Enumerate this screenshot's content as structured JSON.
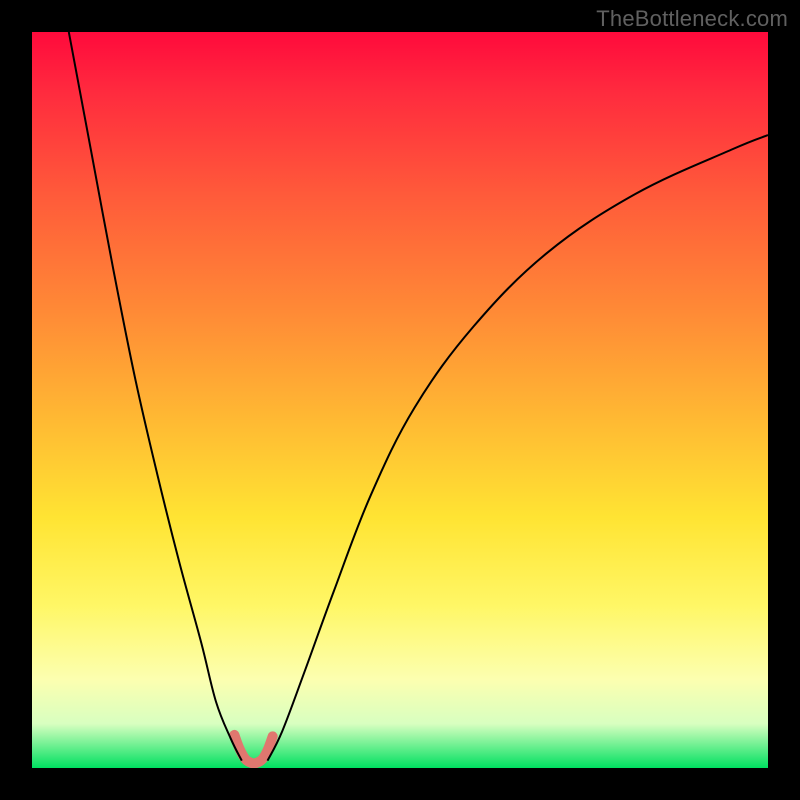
{
  "watermark": "TheBottleneck.com",
  "chart_data": {
    "type": "line",
    "title": "",
    "xlabel": "",
    "ylabel": "",
    "xlim": [
      0,
      100
    ],
    "ylim": [
      0,
      100
    ],
    "background_gradient": {
      "orientation": "vertical",
      "stops": [
        {
          "pos": 0,
          "color": "#ff0a3c"
        },
        {
          "pos": 22,
          "color": "#ff5a3a"
        },
        {
          "pos": 52,
          "color": "#ffb733"
        },
        {
          "pos": 78,
          "color": "#fff766"
        },
        {
          "pos": 94,
          "color": "#d8ffc0"
        },
        {
          "pos": 100,
          "color": "#00e060"
        }
      ]
    },
    "series": [
      {
        "name": "curve-left",
        "stroke": "#000000",
        "stroke_width": 2,
        "x": [
          5,
          8,
          11,
          14,
          17,
          20,
          23,
          25,
          27,
          28.5
        ],
        "y": [
          100,
          84,
          68,
          53,
          40,
          28,
          17,
          9,
          4,
          1
        ]
      },
      {
        "name": "curve-right",
        "stroke": "#000000",
        "stroke_width": 2,
        "x": [
          32,
          34,
          37,
          41,
          46,
          52,
          60,
          70,
          82,
          95,
          100
        ],
        "y": [
          1,
          5,
          13,
          24,
          37,
          49,
          60,
          70,
          78,
          84,
          86
        ]
      },
      {
        "name": "valley-highlight",
        "stroke": "#e0776f",
        "stroke_width": 10,
        "linecap": "round",
        "x": [
          27.5,
          28.2,
          29.0,
          29.8,
          30.5,
          31.3,
          32.0,
          32.7
        ],
        "y": [
          4.5,
          2.6,
          1.2,
          0.7,
          0.7,
          1.2,
          2.4,
          4.3
        ]
      }
    ]
  }
}
